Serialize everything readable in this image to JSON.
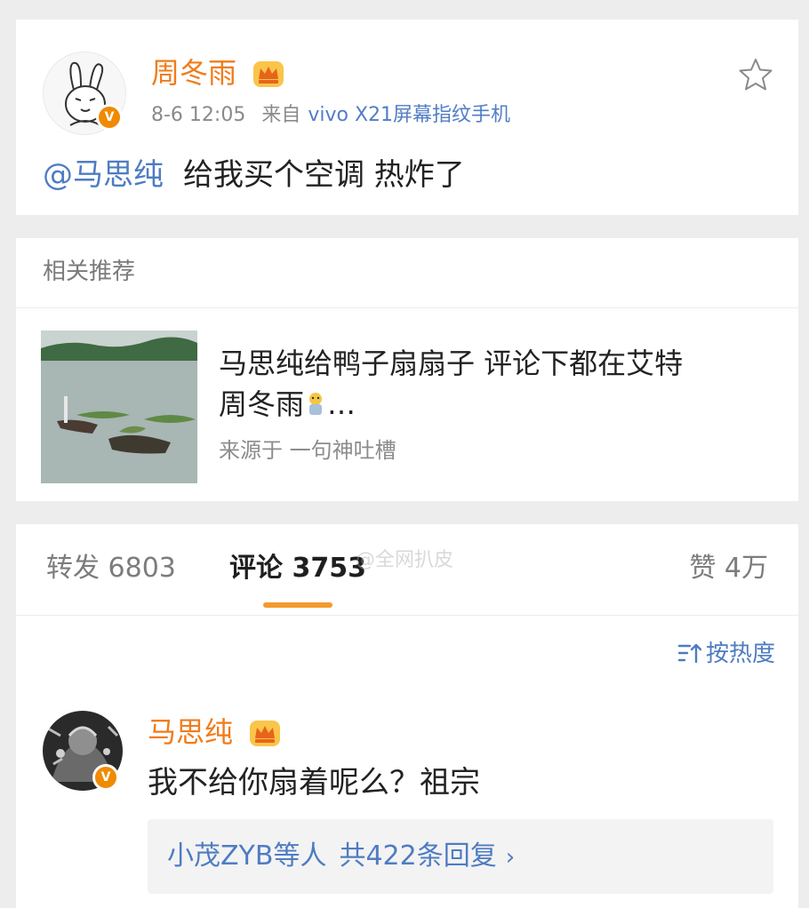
{
  "post": {
    "username": "周冬雨",
    "verified_badge": "V",
    "time": "8-6 12:05",
    "from_label": "来自",
    "device": "vivo X21屏幕指纹手机",
    "mention": "@马思纯",
    "text": "给我买个空调 热炸了",
    "icons": [
      "crown-icon",
      "star-icon",
      "verified-icon"
    ]
  },
  "related": {
    "header": "相关推荐",
    "title_line1": "马思纯给鸭子扇扇子 评论下都在艾特",
    "title_line2_name": "周冬雨",
    "title_line2_ellipsis": "…",
    "source": "来源于 一句神吐槽"
  },
  "tabs": {
    "repost": "转发 6803",
    "comments": "评论 3753",
    "likes": "赞 4万",
    "watermark": "@全网扒皮"
  },
  "sort": {
    "label": "按热度"
  },
  "comment": {
    "username": "马思纯",
    "verified_badge": "V",
    "text": "我不给你扇着呢么？祖宗",
    "replies_who": "小茂ZYB等人",
    "replies_count": "共422条回复",
    "replies_chevron": "›"
  },
  "colors": {
    "username": "#f07c1b",
    "link": "#4e7cc2",
    "accent_underline": "#f39a2e",
    "verified": "#f08a00"
  }
}
